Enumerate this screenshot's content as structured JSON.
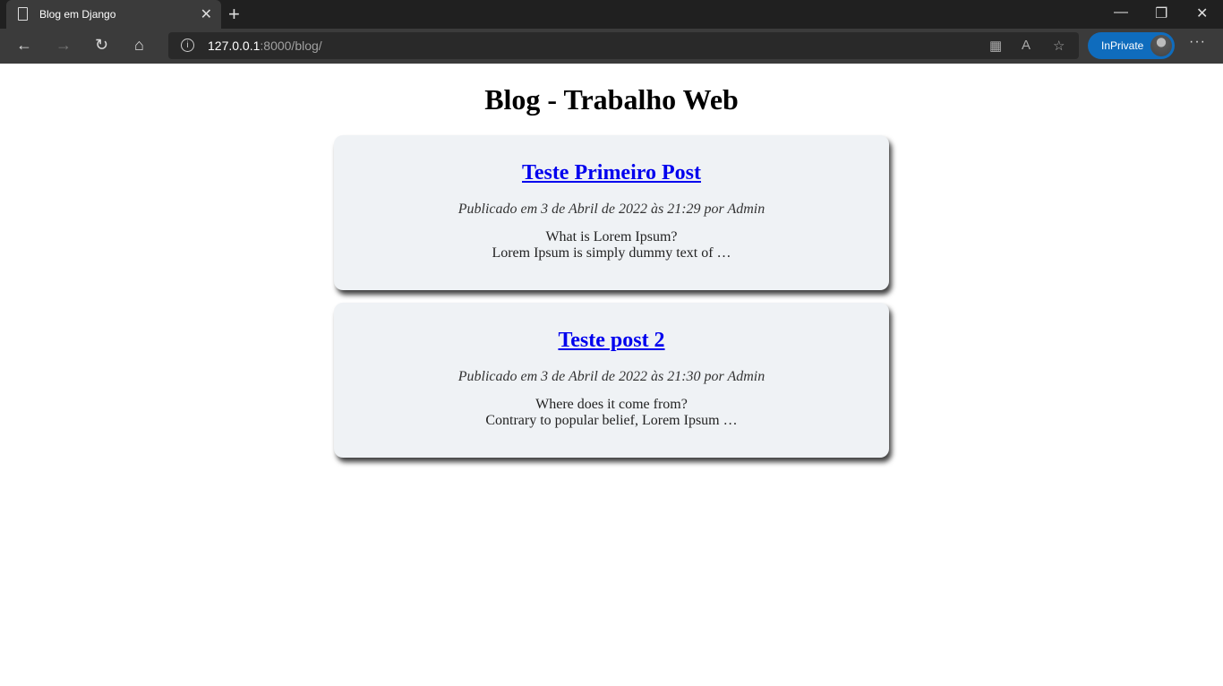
{
  "browser": {
    "tab_title": "Blog em Django",
    "url_host": "127.0.0.1",
    "url_rest": ":8000/blog/",
    "inprivate_label": "InPrivate"
  },
  "page": {
    "title": "Blog - Trabalho Web"
  },
  "posts": [
    {
      "title": "Teste Primeiro Post",
      "meta": "Publicado em 3 de Abril de 2022 às 21:29 por Admin",
      "excerpt_line1": "What is Lorem Ipsum?",
      "excerpt_line2": "Lorem Ipsum is simply dummy text of …"
    },
    {
      "title": "Teste post 2",
      "meta": "Publicado em 3 de Abril de 2022 às 21:30 por Admin",
      "excerpt_line1": "Where does it come from?",
      "excerpt_line2": "Contrary to popular belief, Lorem Ipsum …"
    }
  ]
}
